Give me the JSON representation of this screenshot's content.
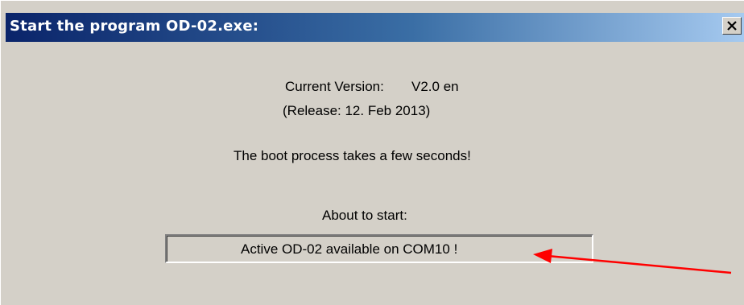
{
  "window": {
    "title": "Start the program OD-02.exe:",
    "close_glyph": "X",
    "close_icon": "close-icon"
  },
  "info": {
    "version_label": "Current Version:",
    "version_value": "V2.0 en",
    "release": "(Release: 12. Feb 2013)",
    "boot_message": "The boot process takes a few seconds!",
    "about_label": "About to start:",
    "status_text": "Active OD-02 available on COM10 !"
  },
  "colors": {
    "title_start": "#0a246a",
    "title_end": "#a6caf0",
    "dialog_bg": "#d4d0c8",
    "annotation_arrow": "#ff0000"
  }
}
